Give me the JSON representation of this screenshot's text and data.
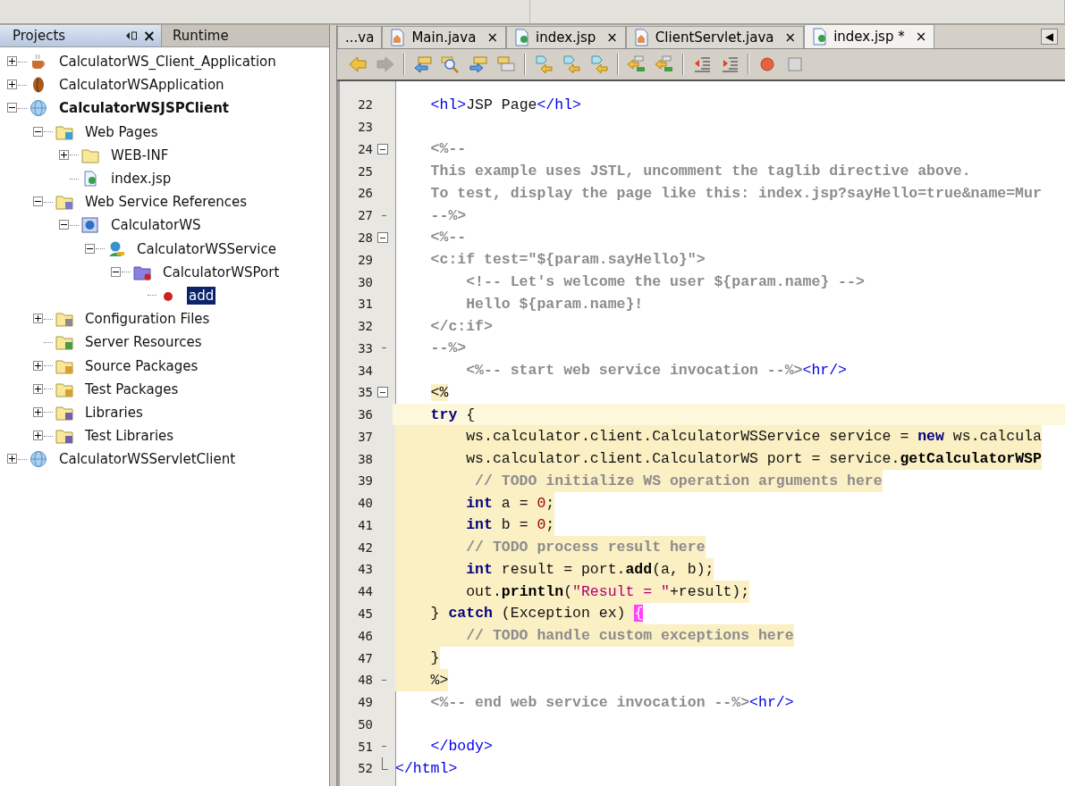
{
  "projects_panel": {
    "tabs": [
      {
        "label": "Projects",
        "selected": true,
        "close": "×"
      },
      {
        "label": "Runtime",
        "selected": false
      }
    ],
    "tree": [
      {
        "label": "CalculatorWS_Client_Application",
        "kind": "cup",
        "expanded": false,
        "selected": false,
        "main": false
      },
      {
        "label": "CalculatorWSApplication",
        "kind": "bean",
        "expanded": false,
        "selected": false,
        "main": false
      },
      {
        "label": "CalculatorWSJSPClient",
        "kind": "globe",
        "expanded": true,
        "selected": false,
        "main": true,
        "children": [
          {
            "label": "Web Pages",
            "kind": "folder-web",
            "expanded": true,
            "selected": false,
            "children": [
              {
                "label": "WEB-INF",
                "kind": "folder",
                "expanded": false,
                "selected": false
              },
              {
                "label": "index.jsp",
                "kind": "jsp",
                "selected": false
              }
            ]
          },
          {
            "label": "Web Service References",
            "kind": "folder-ws",
            "expanded": true,
            "selected": false,
            "children": [
              {
                "label": "CalculatorWS",
                "kind": "ws",
                "expanded": true,
                "selected": false,
                "children": [
                  {
                    "label": "CalculatorWSService",
                    "kind": "service",
                    "expanded": true,
                    "selected": false,
                    "children": [
                      {
                        "label": "CalculatorWSPort",
                        "kind": "port",
                        "expanded": true,
                        "selected": false,
                        "children": [
                          {
                            "label": "add",
                            "kind": "method",
                            "selected": true
                          }
                        ]
                      }
                    ]
                  }
                ]
              }
            ]
          },
          {
            "label": "Configuration Files",
            "kind": "folder-config",
            "expanded": false,
            "selected": false
          },
          {
            "label": "Server Resources",
            "kind": "folder-server",
            "selected": false
          },
          {
            "label": "Source Packages",
            "kind": "folder-package",
            "expanded": false,
            "selected": false
          },
          {
            "label": "Test Packages",
            "kind": "folder-package",
            "expanded": false,
            "selected": false
          },
          {
            "label": "Libraries",
            "kind": "folder-library",
            "expanded": false,
            "selected": false
          },
          {
            "label": "Test Libraries",
            "kind": "folder-library",
            "expanded": false,
            "selected": false
          }
        ]
      },
      {
        "label": "CalculatorWSServletClient",
        "kind": "globe",
        "expanded": false,
        "selected": false,
        "main": false
      }
    ]
  },
  "editor": {
    "tabs": [
      {
        "label": "...va",
        "kind": "plain",
        "selected": false
      },
      {
        "label": "Main.java",
        "kind": "java",
        "close": "×",
        "selected": false
      },
      {
        "label": "index.jsp",
        "kind": "jsp",
        "close": "×",
        "selected": false
      },
      {
        "label": "ClientServlet.java",
        "kind": "java",
        "close": "×",
        "selected": false
      },
      {
        "label": "index.jsp *",
        "kind": "jsp",
        "close": "×",
        "selected": true
      }
    ],
    "scroll_left": "◀",
    "toolbar": [
      {
        "kind": "back",
        "disabled": false
      },
      {
        "kind": "forward",
        "disabled": true
      },
      {
        "kind": "sep"
      },
      {
        "kind": "doc-left",
        "disabled": false
      },
      {
        "kind": "find",
        "disabled": false
      },
      {
        "kind": "doc-right",
        "disabled": false
      },
      {
        "kind": "docs",
        "disabled": false
      },
      {
        "kind": "sep"
      },
      {
        "kind": "shape",
        "disabled": false
      },
      {
        "kind": "shape-left",
        "disabled": false
      },
      {
        "kind": "shape-right",
        "disabled": false
      },
      {
        "kind": "sep"
      },
      {
        "kind": "tree-left",
        "disabled": false
      },
      {
        "kind": "tree-right",
        "disabled": false
      },
      {
        "kind": "sep"
      },
      {
        "kind": "outdent",
        "disabled": false
      },
      {
        "kind": "indent",
        "disabled": false
      },
      {
        "kind": "sep"
      },
      {
        "kind": "record",
        "disabled": false
      },
      {
        "kind": "stop",
        "disabled": false
      }
    ],
    "lines": [
      {
        "no": "22",
        "kind": "plain",
        "current": false,
        "guarded": false,
        "tokens": [
          {
            "kind": "tag",
            "text": "    <hl>"
          },
          {
            "kind": "plain",
            "text": "JSP Page"
          },
          {
            "kind": "tag",
            "text": "</hl>"
          }
        ]
      },
      {
        "no": "23",
        "kind": "plain",
        "current": false
      },
      {
        "no": "24",
        "kind": "opener",
        "current": false,
        "guarded": false,
        "tokens": [
          {
            "kind": "comment",
            "text": "    <%--"
          }
        ]
      },
      {
        "no": "25",
        "kind": "plain",
        "current": false,
        "guarded": false,
        "tokens": [
          {
            "kind": "comment",
            "text": "    This example uses JSTL, uncomment the taglib directive above."
          }
        ]
      },
      {
        "no": "26",
        "kind": "plain",
        "current": false,
        "guarded": false,
        "tokens": [
          {
            "kind": "comment",
            "text": "    To test, display the page like this: index.jsp?sayHello=true&name=Mur"
          }
        ]
      },
      {
        "no": "27",
        "kind": "closer",
        "current": false,
        "guarded": false,
        "tokens": [
          {
            "kind": "comment",
            "text": "    --%>"
          }
        ]
      },
      {
        "no": "28",
        "kind": "opener",
        "current": false,
        "guarded": false,
        "tokens": [
          {
            "kind": "comment",
            "text": "    <%--"
          }
        ]
      },
      {
        "no": "29",
        "kind": "plain",
        "current": false,
        "guarded": false,
        "tokens": [
          {
            "kind": "comment",
            "text": "    <c:if test=\"${param.sayHello}\">"
          }
        ]
      },
      {
        "no": "30",
        "kind": "plain",
        "current": false,
        "guarded": false,
        "tokens": [
          {
            "kind": "comment",
            "text": "        <!-- Let's welcome the user ${param.name} -->"
          }
        ]
      },
      {
        "no": "31",
        "kind": "plain",
        "current": false,
        "guarded": false,
        "tokens": [
          {
            "kind": "comment",
            "text": "        Hello ${param.name}!"
          }
        ]
      },
      {
        "no": "32",
        "kind": "plain",
        "current": false,
        "guarded": false,
        "tokens": [
          {
            "kind": "comment",
            "text": "    </c:if>"
          }
        ]
      },
      {
        "no": "33",
        "kind": "closer",
        "current": false,
        "guarded": false,
        "tokens": [
          {
            "kind": "comment",
            "text": "    --%>"
          }
        ]
      },
      {
        "no": "34",
        "kind": "plain",
        "current": false,
        "guarded": false,
        "tokens": [
          {
            "kind": "comment",
            "text": "        <%-- start web service invocation --%>"
          },
          {
            "kind": "tag",
            "text": "<hr/>"
          }
        ]
      },
      {
        "no": "35",
        "kind": "opener",
        "current": false,
        "guarded": false,
        "tokens": [
          {
            "kind": "scriptlet",
            "text": "<%"
          }
        ]
      },
      {
        "no": "36",
        "kind": "plain",
        "current": true,
        "guarded": false,
        "tokens": [
          {
            "kind": "keyword",
            "text": "    try"
          },
          {
            "kind": "plain",
            "text": " {"
          }
        ]
      },
      {
        "no": "37",
        "kind": "plain",
        "current": false,
        "guarded": true,
        "tokens": [
          {
            "kind": "plain",
            "text": "        ws.calculator.client.CalculatorWSService service = "
          },
          {
            "kind": "keyword",
            "text": "new"
          },
          {
            "kind": "plain",
            "text": " ws.calcula"
          }
        ]
      },
      {
        "no": "38",
        "kind": "plain",
        "current": false,
        "guarded": true,
        "tokens": [
          {
            "kind": "plain",
            "text": "        ws.calculator.client.CalculatorWS port = service."
          },
          {
            "kind": "method",
            "text": "getCalculatorWSP"
          }
        ]
      },
      {
        "no": "39",
        "kind": "plain",
        "current": false,
        "guarded": true,
        "tokens": [
          {
            "kind": "comment",
            "text": "         // TODO initialize WS operation arguments here"
          }
        ]
      },
      {
        "no": "40",
        "kind": "plain",
        "current": false,
        "guarded": true,
        "tokens": [
          {
            "kind": "keyword",
            "text": "        int"
          },
          {
            "kind": "plain",
            "text": " a = "
          },
          {
            "kind": "number",
            "text": "0"
          },
          {
            "kind": "plain",
            "text": ";"
          }
        ]
      },
      {
        "no": "41",
        "kind": "plain",
        "current": false,
        "guarded": true,
        "tokens": [
          {
            "kind": "keyword",
            "text": "        int"
          },
          {
            "kind": "plain",
            "text": " b = "
          },
          {
            "kind": "number",
            "text": "0"
          },
          {
            "kind": "plain",
            "text": ";"
          }
        ]
      },
      {
        "no": "42",
        "kind": "plain",
        "current": false,
        "guarded": true,
        "tokens": [
          {
            "kind": "comment",
            "text": "        // TODO process result here"
          }
        ]
      },
      {
        "no": "43",
        "kind": "plain",
        "current": false,
        "guarded": true,
        "tokens": [
          {
            "kind": "keyword",
            "text": "        int"
          },
          {
            "kind": "plain",
            "text": " result = port."
          },
          {
            "kind": "method",
            "text": "add"
          },
          {
            "kind": "plain",
            "text": "(a, b);"
          }
        ]
      },
      {
        "no": "44",
        "kind": "plain",
        "current": false,
        "guarded": true,
        "tokens": [
          {
            "kind": "plain",
            "text": "        out."
          },
          {
            "kind": "method",
            "text": "println"
          },
          {
            "kind": "plain",
            "text": "("
          },
          {
            "kind": "string",
            "text": "\"Result = \""
          },
          {
            "kind": "plain",
            "text": "+result);"
          }
        ]
      },
      {
        "no": "45",
        "kind": "plain",
        "current": false,
        "guarded": true,
        "tokens": [
          {
            "kind": "plain",
            "text": "    } "
          },
          {
            "kind": "keyword",
            "text": "catch"
          },
          {
            "kind": "plain",
            "text": " (Exception ex) "
          },
          {
            "kind": "match",
            "text": "{"
          }
        ]
      },
      {
        "no": "46",
        "kind": "plain",
        "current": false,
        "guarded": true,
        "tokens": [
          {
            "kind": "comment",
            "text": "        // TODO handle custom exceptions here"
          }
        ]
      },
      {
        "no": "47",
        "kind": "plain",
        "current": false,
        "guarded": true,
        "tokens": [
          {
            "kind": "plain",
            "text": "    }"
          }
        ]
      },
      {
        "no": "48",
        "kind": "closer",
        "current": false,
        "guarded": true,
        "tokens": [
          {
            "kind": "plain",
            "text": "    %>"
          }
        ]
      },
      {
        "no": "49",
        "kind": "plain",
        "current": false,
        "guarded": false,
        "tokens": [
          {
            "kind": "comment",
            "text": "    <%-- end web service invocation --%>"
          },
          {
            "kind": "tag",
            "text": "<hr/>"
          }
        ]
      },
      {
        "no": "50",
        "kind": "plain",
        "current": false
      },
      {
        "no": "51",
        "kind": "closer",
        "current": false,
        "guarded": false,
        "tokens": [
          {
            "kind": "tag",
            "text": "    </body>"
          }
        ]
      },
      {
        "no": "52",
        "kind": "last",
        "current": false,
        "guarded": false,
        "tokens": [
          {
            "kind": "tag",
            "text": "</html>"
          }
        ]
      }
    ]
  }
}
